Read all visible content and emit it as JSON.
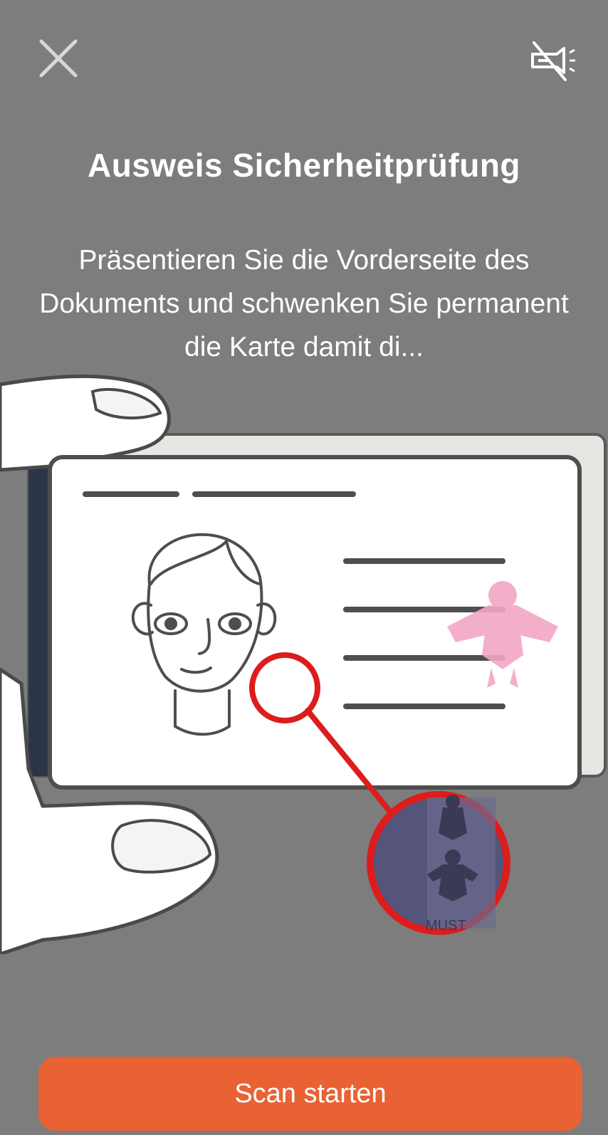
{
  "header": {
    "close_icon": "close-icon",
    "torch_icon": "flashlight-off-icon"
  },
  "title": "Ausweis Sicherheitprüfung",
  "instructions": "Präsentieren Sie die Vorderseite des Dokuments und schwenken Sie permanent die Karte damit di...",
  "illustration": {
    "magnifier_watermark": "MUST",
    "colors": {
      "lens": "#dd1c1c",
      "eagle": "#f2a7c4",
      "lens_fill": "#55547a"
    }
  },
  "cta": {
    "label": "Scan starten",
    "color": "#e86233"
  }
}
